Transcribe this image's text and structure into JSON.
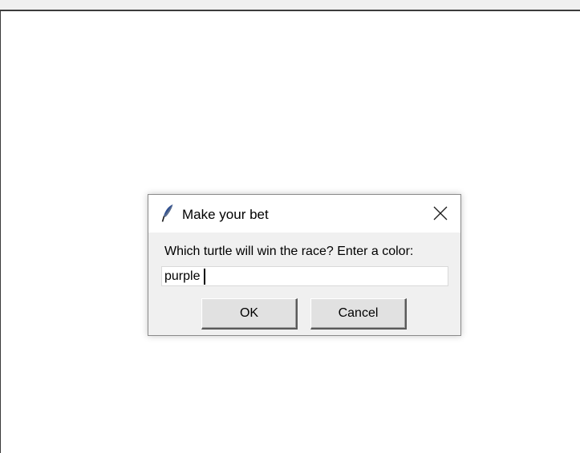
{
  "dialog": {
    "title": "Make your bet",
    "prompt": "Which turtle will win the race? Enter a color:",
    "input_value": "purple",
    "ok_label": "OK",
    "cancel_label": "Cancel"
  },
  "icons": {
    "app": "feather-icon",
    "close": "close-icon"
  },
  "colors": {
    "dialog_body": "#f0f0f0",
    "titlebar": "#ffffff",
    "button_face": "#e1e1e1"
  }
}
